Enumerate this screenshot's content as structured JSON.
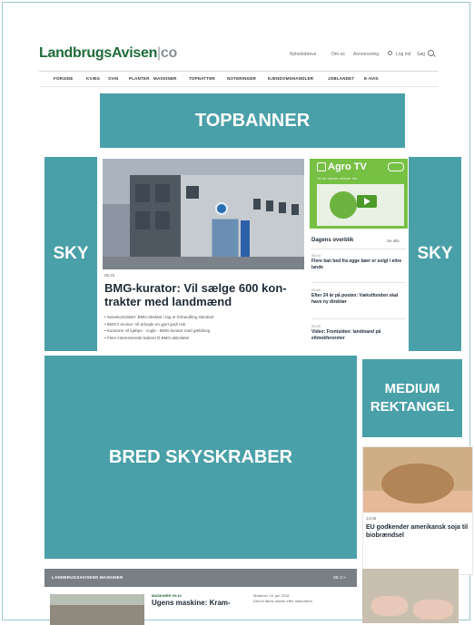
{
  "header": {
    "logo_main": "LandbrugsAvisen",
    "logo_sep": "|",
    "logo_co": "co",
    "util_links": [
      "Nyhedsbreve",
      "Om os",
      "Annoncering",
      "Log ind",
      "Søg"
    ]
  },
  "nav": {
    "items": [
      "FORSIDE",
      "KVÆG",
      "SVIN",
      "PLANTER",
      "MASKINER",
      "TOPNATTER",
      "NOTERINGER",
      "EJENDOMSHANDLER",
      "JOBLANDET",
      "E-AVIS"
    ]
  },
  "ads": {
    "topbanner": "TOPBANNER",
    "sky_left": "SKY",
    "sky_right": "SKY",
    "bred": "BRED SKYSKRABER",
    "medium_line1": "MEDIUM",
    "medium_line2": "REKTANGEL"
  },
  "main_article": {
    "time": "06:22",
    "title": "BMG-kurator: Vil sælge 600 kon­trakter med landmænd",
    "bullets": [
      "Svinekontrakter: BMG-direktør i tag er forhandling standset",
      "BMG's revisor: Vil arbejde en gjort godt nok",
      "Kuratorer vil kjøbpe - nogle - BMG-kurator med gældning",
      "Flere interesserede købere til BMG-aktiviteter"
    ]
  },
  "agro_tv": {
    "title": "Agro TV",
    "subtitle": "Se de nyeste videoer her"
  },
  "dagens": {
    "heading": "Dagens overblik",
    "see_all": "Se alle",
    "items": [
      {
        "time": "09:44",
        "text": "Flere kan bed fra egge køer er solgt i eitre lande"
      },
      {
        "time": "09:40",
        "text": "Efter 24 år på posten: Vækstfonden skal have ny direktør"
      },
      {
        "time": "09:29",
        "text": "Video: Frontsiden: landmand på eltmokferoreter"
      }
    ]
  },
  "right_card": {
    "time": "13:05",
    "title": "EU godkender amerikansk soja til biobrændsel"
  },
  "bottom": {
    "bar_title": "LANDBRUGSAVISENS MASKINER",
    "bar_more": "SE 3 >",
    "category": "MASKINER 09:16",
    "title": "Ugens maskine: Kram-",
    "meta": "Maskiner  16. jan 2018\nDenne fabrio støder efter traktorfemt"
  }
}
